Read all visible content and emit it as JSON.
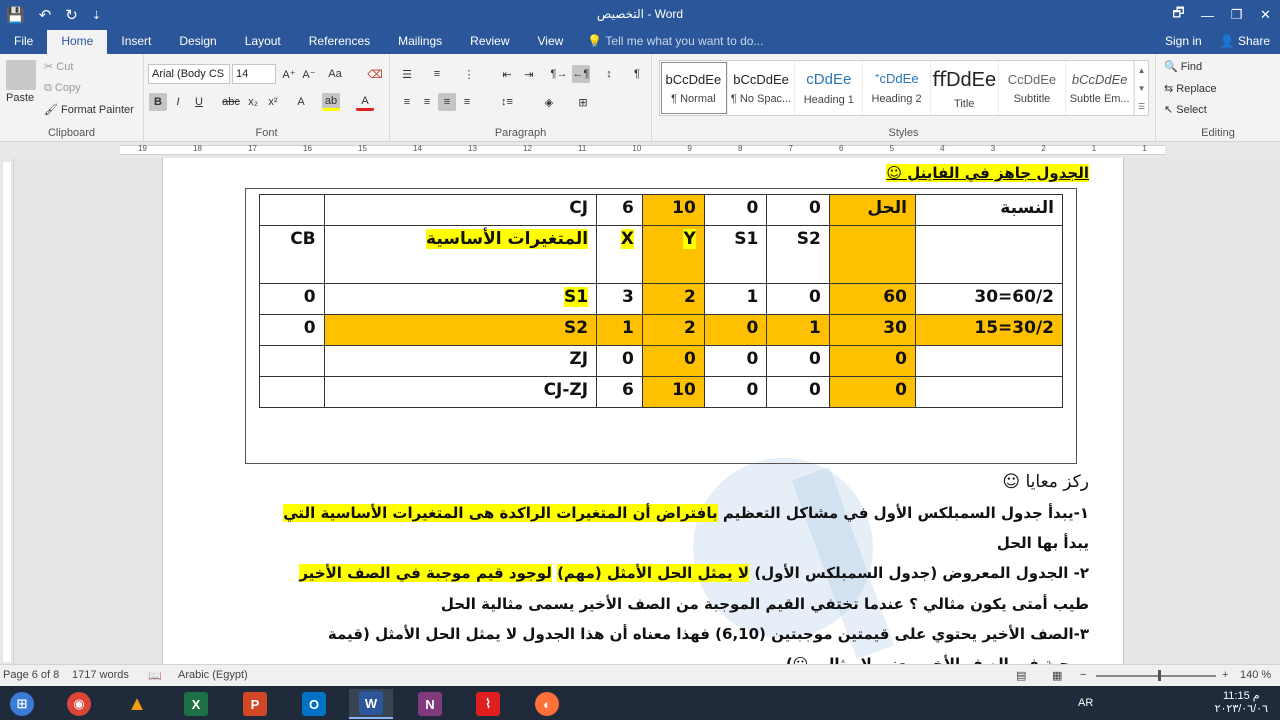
{
  "window": {
    "title": "التخصيص - Word",
    "controls": [
      "🗗",
      "—",
      "❐",
      "✕"
    ]
  },
  "qat": {
    "save": "💾",
    "undo": "↶",
    "redo": "↻",
    "more": "⇣"
  },
  "tabs": [
    {
      "label": "File"
    },
    {
      "label": "Home"
    },
    {
      "label": "Insert"
    },
    {
      "label": "Design"
    },
    {
      "label": "Layout"
    },
    {
      "label": "References"
    },
    {
      "label": "Mailings"
    },
    {
      "label": "Review"
    },
    {
      "label": "View"
    }
  ],
  "tell_me": "Tell me what you want to do...",
  "account": {
    "signin": "Sign in",
    "share": "Share"
  },
  "clipboard": {
    "paste": "Paste",
    "cut": "Cut",
    "copy": "Copy",
    "format_painter": "Format Painter",
    "group": "Clipboard"
  },
  "font": {
    "name": "Arial (Body CS",
    "size": "14",
    "group": "Font"
  },
  "paragraph": {
    "group": "Paragraph"
  },
  "styles": {
    "group": "Styles",
    "items": [
      {
        "preview": "bCcDdEe",
        "name": "¶ Normal"
      },
      {
        "preview": "bCcDdEe",
        "name": "¶ No Spac..."
      },
      {
        "preview": "cDdEe",
        "name": "Heading 1"
      },
      {
        "preview": "ᐩcDdEe",
        "name": "Heading 2"
      },
      {
        "preview": "ﬀDdEe",
        "name": "Title"
      },
      {
        "preview": "CcDdEe",
        "name": "Subtitle"
      },
      {
        "preview": "bCcDdEe",
        "name": "Subtle Em..."
      }
    ]
  },
  "editing": {
    "find": "Find",
    "replace": "Replace",
    "select": "Select",
    "group": "Editing"
  },
  "ruler_numbers": [
    "19",
    "18",
    "17",
    "16",
    "15",
    "14",
    "13",
    "12",
    "11",
    "10",
    "9",
    "8",
    "7",
    "6",
    "5",
    "4",
    "3",
    "2",
    "1",
    "1"
  ],
  "doc": {
    "heading": "الجدول جاهز في الفاينل ☺",
    "table": {
      "rows": [
        [
          "النسبة",
          "الحل",
          "0",
          "0",
          "10",
          "6",
          "CJ",
          ""
        ],
        [
          "",
          "",
          "S2",
          "S1",
          "Y",
          "X",
          "المتغيرات الأساسية",
          "CB"
        ],
        [
          "60/2=30",
          "60",
          "0",
          "1",
          "2",
          "3",
          "S1",
          "0"
        ],
        [
          "30/2=15",
          "30",
          "1",
          "0",
          "2",
          "1",
          "S2",
          "0"
        ],
        [
          "",
          "0",
          "0",
          "0",
          "0",
          "0",
          "ZJ",
          ""
        ],
        [
          "",
          "0",
          "0",
          "0",
          "10",
          "6",
          "CJ-ZJ",
          ""
        ]
      ]
    },
    "focus": "ركز معايا ☺",
    "p1_a": "١-يبدأ جدول السمبلكس الأول في مشاكل التعظيم",
    "p1_b": "بافتراض أن المتغيرات الراكدة هى المتغيرات الأساسية التي",
    "p1_c": "يبدأ بها الحل",
    "p2_a": "٢-",
    "p2_b": "الجدول المعروض (جدول السمبلكس الأول)",
    "p2_c": "لا يمثل الحل الأمثل (مهم)",
    "p2_d": "لوجود قيم موجبة في الصف الأخير",
    "p3": "طيب أمتى يكون مثالي ؟ عندما تختفي القيم الموجبة من الصف الأخير يسمى مثالية الحل",
    "p4": "٣-الصف الأخير يحتوي على قيمتين موجبتين (6,10) فهذا معناه أن هذا الجدول لا يمثل الحل الأمثل   (قيمة",
    "p5": "موجبة في الصف الأخير يعني لا مثالي ☹)"
  },
  "status": {
    "page": "Page 6 of 8",
    "words": "1717 words",
    "lang": "Arabic (Egypt)",
    "zoom": "140 %"
  },
  "taskbar": {
    "lang": "AR",
    "time": "11:15 م",
    "date": "٢٠٢٣/٠٦/٠٦"
  },
  "colors": {
    "word_blue": "#2b579a",
    "orange": "#ffc000",
    "yellow": "#ffff00"
  }
}
